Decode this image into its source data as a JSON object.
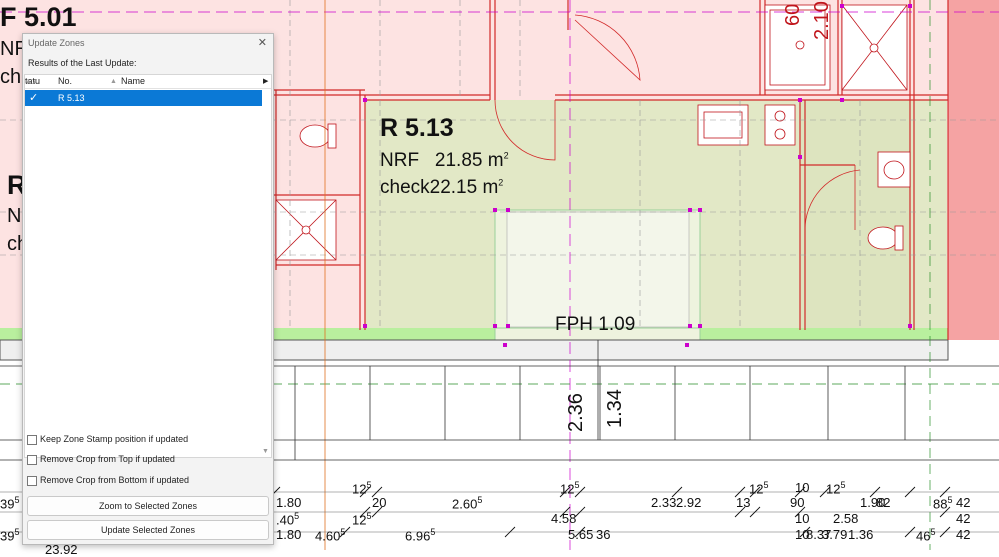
{
  "plan": {
    "room_main": {
      "code": "R 5.13",
      "nrf_label": "NRF",
      "nrf_value": "21.85 m",
      "check_label": "check",
      "check_value": "22.15 m",
      "sq": "2"
    },
    "room_left_top": "F 5.01",
    "room_left_nrf": "NRF",
    "room_left_check": "check",
    "room_left_mid": "R",
    "room_left_mid_nrf": "NI",
    "room_left_mid_check": "ch",
    "shaft_label": "FPH 1.09",
    "vertical_dims": {
      "a": "2.36",
      "b": "1.34",
      "top1": "60",
      "top2": "2.10"
    },
    "dims_row1": [
      {
        "t": "1.80"
      },
      {
        "t": "20"
      },
      {
        "t": "2.60",
        "s": "5"
      },
      {
        "t": "2.33"
      },
      {
        "t": "2.92"
      },
      {
        "t": "13"
      },
      {
        "t": "90"
      },
      {
        "t": "1.90"
      },
      {
        "t": "82"
      },
      {
        "t": "88",
        "s": "5"
      },
      {
        "t": "42"
      }
    ],
    "dims_row1_super": [
      {
        "t": "12",
        "s": "5"
      },
      {
        "t": "12",
        "s": "5"
      },
      {
        "t": "12",
        "s": "5"
      },
      {
        "t": "10"
      },
      {
        "t": "12",
        "s": "5"
      }
    ],
    "dims_row2": [
      {
        "t": ".40",
        "s": "5"
      },
      {
        "t": "12",
        "s": "5"
      },
      {
        "t": "4.58"
      },
      {
        "t": "10"
      },
      {
        "t": "2.58"
      },
      {
        "t": "42"
      }
    ],
    "dims_row3": [
      {
        "t": "1.80"
      },
      {
        "t": "4.60",
        "s": "5"
      },
      {
        "t": "6.96",
        "s": "5"
      },
      {
        "t": "5.65"
      },
      {
        "t": "36"
      },
      {
        "t": "10"
      },
      {
        "t": "8.37"
      },
      {
        "t": "3.79"
      },
      {
        "t": "1.36"
      },
      {
        "t": "46",
        "s": "5"
      },
      {
        "t": "42"
      }
    ],
    "dims_left": {
      "r1": "39",
      "r1s": "5",
      "r3": "39",
      "r3s": "5",
      "bottom": "23.92"
    }
  },
  "dialog": {
    "title": "Update Zones",
    "subtitle": "Results of the Last Update:",
    "columns": {
      "status": "tatu",
      "no": "No.",
      "name": "Name"
    },
    "rows": [
      {
        "no": "R 5.13"
      }
    ],
    "options": [
      "Keep Zone Stamp position if updated",
      "Remove Crop from Top if updated",
      "Remove Crop from Bottom if updated"
    ],
    "buttons": {
      "zoom": "Zoom to Selected Zones",
      "update": "Update Selected Zones"
    }
  },
  "colors": {
    "selection": "#0b79d6",
    "zone_fill": "#e2e8c6",
    "wall_red": "#d22a2a",
    "pink": "#fde3e2",
    "green_band": "#b9ef9e",
    "magenta": "#cc00cc"
  }
}
